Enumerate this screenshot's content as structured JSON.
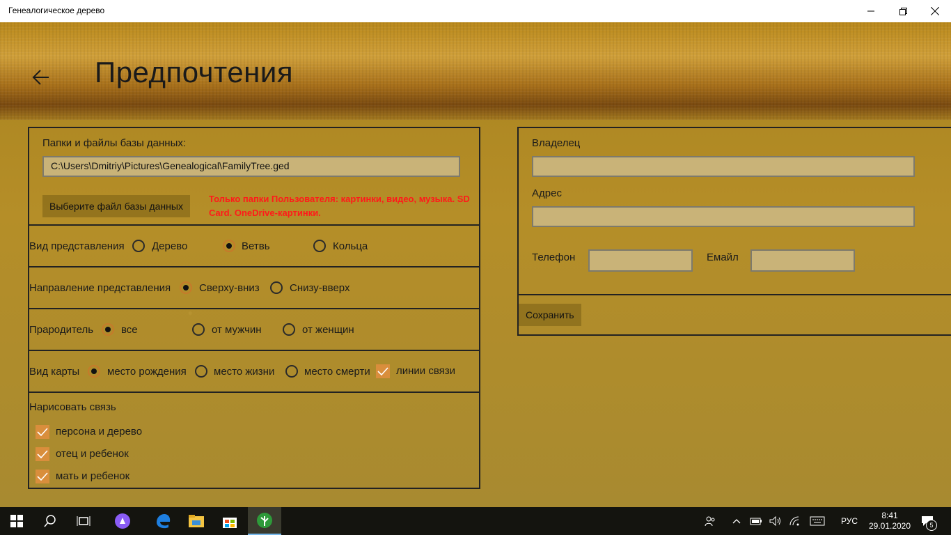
{
  "window": {
    "title": "Генеалогическое дерево"
  },
  "page": {
    "title": "Предпочтения"
  },
  "database": {
    "label": "Папки и файлы базы данных:",
    "path": "C:\\Users\\Dmitriy\\Pictures\\Genealogical\\FamilyTree.ged",
    "choose_button": "Выберите файл базы данных",
    "warning": "Только папки Пользователя: картинки, видео, музыка. SD Card. OneDrive-картинки."
  },
  "view": {
    "label": "Вид представления",
    "options": [
      "Дерево",
      "Ветвь",
      "Кольца"
    ],
    "selected": "Ветвь"
  },
  "direction": {
    "label": "Направление представления",
    "options": [
      "Сверху-вниз",
      "Снизу-вверх"
    ],
    "selected": "Сверху-вниз"
  },
  "ancestor": {
    "label": "Прародитель",
    "options": [
      "все",
      "от мужчин",
      "от женщин"
    ],
    "selected": "все"
  },
  "map": {
    "label": "Вид карты",
    "options": [
      "место рождения",
      "место жизни",
      "место смерти"
    ],
    "selected": "место рождения",
    "lines_label": "линии связи",
    "lines_checked": true
  },
  "links": {
    "label": "Нарисовать связь",
    "items": [
      {
        "label": "персона и дерево",
        "checked": true
      },
      {
        "label": "отец и ребенок",
        "checked": true
      },
      {
        "label": "мать и ребенок",
        "checked": true
      }
    ]
  },
  "owner": {
    "owner_label": "Владелец",
    "owner_value": "",
    "address_label": "Адрес",
    "address_value": "",
    "phone_label": "Телефон",
    "phone_value": "",
    "email_label": "Емайл",
    "email_value": "",
    "save_button": "Сохранить"
  },
  "taskbar": {
    "language": "РУС",
    "time": "8:41",
    "date": "29.01.2020",
    "notifications": "5"
  },
  "colors": {
    "accent": "#d98e3c",
    "warning": "#ff1a1a",
    "taskbar": "#14140f"
  }
}
